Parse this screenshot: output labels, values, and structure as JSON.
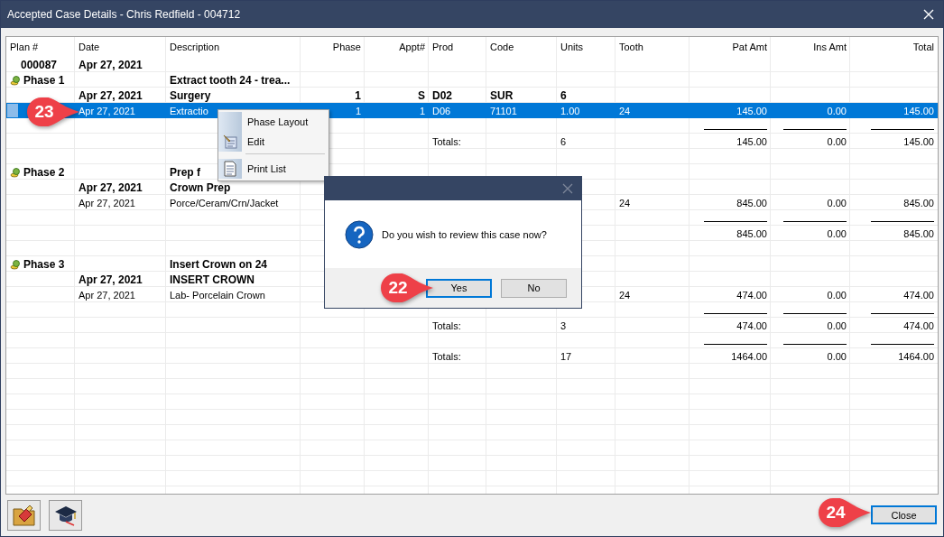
{
  "window": {
    "title": "Accepted Case Details - Chris Redfield - 004712"
  },
  "table": {
    "columns": [
      "Plan #",
      "Date",
      "Description",
      "Phase",
      "Appt#",
      "Prod",
      "Code",
      "Units",
      "Tooth",
      "Pat Amt",
      "Ins Amt",
      "Total"
    ],
    "rows": [
      {
        "kind": "plan",
        "selected": false,
        "cells": [
          "000087",
          "Apr 27, 2021",
          null,
          null,
          null,
          null,
          null,
          null,
          null,
          null,
          null,
          null
        ]
      },
      {
        "kind": "phase",
        "selected": false,
        "cells": [
          "Phase 1",
          null,
          "Extract tooth 24 - trea...",
          null,
          null,
          null,
          null,
          null,
          null,
          null,
          null,
          null
        ]
      },
      {
        "kind": "appt",
        "selected": false,
        "cells": [
          null,
          "Apr 27, 2021",
          "Surgery",
          "1",
          "S",
          "D02",
          "SUR",
          "6",
          null,
          null,
          null,
          null
        ]
      },
      {
        "kind": "item",
        "selected": true,
        "cells": [
          null,
          "Apr 27, 2021",
          "Extractio",
          "1",
          "1",
          "D06",
          "71101",
          "1.00",
          "24",
          "145.00",
          "0.00",
          "145.00"
        ]
      },
      {
        "kind": "rule",
        "selected": false,
        "cells": []
      },
      {
        "kind": "totals",
        "selected": false,
        "cells": [
          null,
          null,
          null,
          null,
          null,
          "Totals:",
          null,
          "6",
          null,
          "145.00",
          "0.00",
          "145.00"
        ]
      },
      {
        "kind": "blank",
        "selected": false,
        "cells": []
      },
      {
        "kind": "phase",
        "selected": false,
        "cells": [
          "Phase 2",
          null,
          "Prep f",
          null,
          null,
          null,
          null,
          null,
          null,
          null,
          null,
          null
        ]
      },
      {
        "kind": "appt",
        "selected": false,
        "cells": [
          null,
          "Apr 27, 2021",
          "Crown Prep",
          null,
          null,
          null,
          null,
          null,
          null,
          null,
          null,
          null
        ]
      },
      {
        "kind": "item",
        "selected": false,
        "cells": [
          null,
          "Apr 27, 2021",
          "Porce/Ceram/Crn/Jacket",
          null,
          null,
          null,
          null,
          null,
          "24",
          "845.00",
          "0.00",
          "845.00"
        ]
      },
      {
        "kind": "rule",
        "selected": false,
        "cells": []
      },
      {
        "kind": "totals",
        "selected": false,
        "cells": [
          null,
          null,
          null,
          null,
          null,
          null,
          null,
          null,
          null,
          "845.00",
          "0.00",
          "845.00"
        ]
      },
      {
        "kind": "blank",
        "selected": false,
        "cells": []
      },
      {
        "kind": "phase",
        "selected": false,
        "cells": [
          "Phase 3",
          null,
          "Insert Crown on 24",
          null,
          null,
          null,
          null,
          null,
          null,
          null,
          null,
          null
        ]
      },
      {
        "kind": "appt",
        "selected": false,
        "cells": [
          null,
          "Apr 27, 2021",
          "INSERT CROWN",
          null,
          null,
          null,
          null,
          null,
          null,
          null,
          null,
          null
        ]
      },
      {
        "kind": "item",
        "selected": false,
        "cells": [
          null,
          "Apr 27, 2021",
          "Lab- Porcelain Crown",
          null,
          null,
          null,
          null,
          null,
          "24",
          "474.00",
          "0.00",
          "474.00"
        ]
      },
      {
        "kind": "rule",
        "selected": false,
        "cells": []
      },
      {
        "kind": "totals",
        "selected": false,
        "cells": [
          null,
          null,
          null,
          null,
          null,
          "Totals:",
          null,
          "3",
          null,
          "474.00",
          "0.00",
          "474.00"
        ]
      },
      {
        "kind": "rule",
        "selected": false,
        "cells": []
      },
      {
        "kind": "totals",
        "selected": false,
        "cells": [
          null,
          null,
          null,
          null,
          null,
          "Totals:",
          null,
          "17",
          null,
          "1464.00",
          "0.00",
          "1464.00"
        ]
      }
    ]
  },
  "context_menu": {
    "items": [
      {
        "kind": "plain",
        "label": "Phase Layout"
      },
      {
        "kind": "pencil",
        "label": "Edit"
      },
      {
        "kind": "separator"
      },
      {
        "kind": "document",
        "label": "Print List"
      }
    ]
  },
  "dialog": {
    "message": "Do you wish to review this case now?",
    "buttons": [
      {
        "label": "Yes",
        "default": true
      },
      {
        "label": "No",
        "default": false
      }
    ]
  },
  "footer": {
    "buttons": [
      {
        "label": "Close",
        "default": true
      }
    ]
  },
  "callouts": [
    {
      "number": "23"
    },
    {
      "number": "22"
    },
    {
      "number": "24"
    }
  ]
}
